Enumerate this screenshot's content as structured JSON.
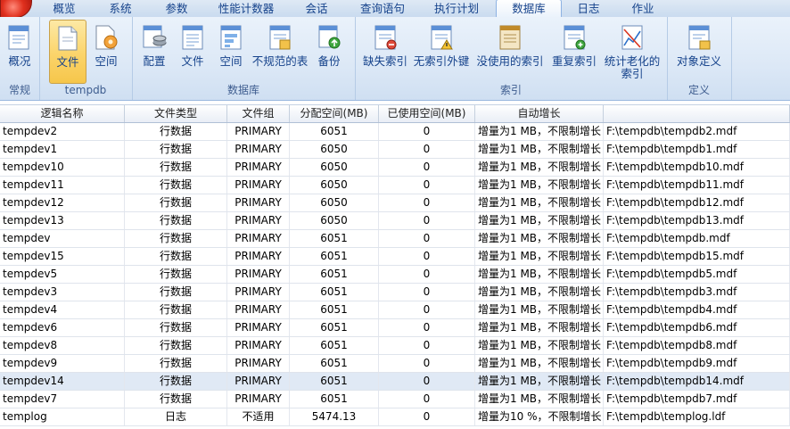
{
  "tabs": [
    {
      "label": "概览"
    },
    {
      "label": "系统"
    },
    {
      "label": "参数"
    },
    {
      "label": "性能计数器"
    },
    {
      "label": "会话"
    },
    {
      "label": "查询语句"
    },
    {
      "label": "执行计划"
    },
    {
      "label": "数据库",
      "active": true
    },
    {
      "label": "日志"
    },
    {
      "label": "作业"
    }
  ],
  "ribbon": {
    "groups": [
      {
        "label": "常规",
        "buttons": [
          {
            "label": "概况",
            "icon": "overview-icon"
          }
        ]
      },
      {
        "label": "tempdb",
        "buttons": [
          {
            "label": "文件",
            "icon": "file-icon",
            "pressed": true
          },
          {
            "label": "空间",
            "icon": "space-icon"
          }
        ]
      },
      {
        "label": "数据库",
        "buttons": [
          {
            "label": "配置",
            "icon": "config-icon"
          },
          {
            "label": "文件",
            "icon": "db-file-icon"
          },
          {
            "label": "空间",
            "icon": "db-space-icon"
          },
          {
            "label": "不规范的表",
            "icon": "irregular-table-icon"
          },
          {
            "label": "备份",
            "icon": "backup-icon"
          }
        ]
      },
      {
        "label": "索引",
        "buttons": [
          {
            "label": "缺失索引",
            "icon": "missing-index-icon"
          },
          {
            "label": "无索引外键",
            "icon": "unindexed-fk-icon"
          },
          {
            "label": "没使用的索引",
            "icon": "unused-index-icon"
          },
          {
            "label": "重复索引",
            "icon": "duplicate-index-icon"
          },
          {
            "label": "统计老化的\n索引",
            "icon": "stale-stats-icon"
          }
        ]
      },
      {
        "label": "定义",
        "buttons": [
          {
            "label": "对象定义",
            "icon": "object-definition-icon"
          }
        ]
      }
    ]
  },
  "grid": {
    "columns": [
      "逻辑名称",
      "文件类型",
      "文件组",
      "分配空间(MB)",
      "已使用空间(MB)",
      "自动增长",
      ""
    ],
    "rows": [
      [
        "tempdev2",
        "行数据",
        "PRIMARY",
        "6051",
        "0",
        "增量为1 MB，不限制增长",
        "F:\\tempdb\\tempdb2.mdf"
      ],
      [
        "tempdev1",
        "行数据",
        "PRIMARY",
        "6050",
        "0",
        "增量为1 MB，不限制增长",
        "F:\\tempdb\\tempdb1.mdf"
      ],
      [
        "tempdev10",
        "行数据",
        "PRIMARY",
        "6050",
        "0",
        "增量为1 MB，不限制增长",
        "F:\\tempdb\\tempdb10.mdf"
      ],
      [
        "tempdev11",
        "行数据",
        "PRIMARY",
        "6050",
        "0",
        "增量为1 MB，不限制增长",
        "F:\\tempdb\\tempdb11.mdf"
      ],
      [
        "tempdev12",
        "行数据",
        "PRIMARY",
        "6050",
        "0",
        "增量为1 MB，不限制增长",
        "F:\\tempdb\\tempdb12.mdf"
      ],
      [
        "tempdev13",
        "行数据",
        "PRIMARY",
        "6050",
        "0",
        "增量为1 MB，不限制增长",
        "F:\\tempdb\\tempdb13.mdf"
      ],
      [
        "tempdev",
        "行数据",
        "PRIMARY",
        "6051",
        "0",
        "增量为1 MB，不限制增长",
        "F:\\tempdb\\tempdb.mdf"
      ],
      [
        "tempdev15",
        "行数据",
        "PRIMARY",
        "6051",
        "0",
        "增量为1 MB，不限制增长",
        "F:\\tempdb\\tempdb15.mdf"
      ],
      [
        "tempdev5",
        "行数据",
        "PRIMARY",
        "6051",
        "0",
        "增量为1 MB，不限制增长",
        "F:\\tempdb\\tempdb5.mdf"
      ],
      [
        "tempdev3",
        "行数据",
        "PRIMARY",
        "6051",
        "0",
        "增量为1 MB，不限制增长",
        "F:\\tempdb\\tempdb3.mdf"
      ],
      [
        "tempdev4",
        "行数据",
        "PRIMARY",
        "6051",
        "0",
        "增量为1 MB，不限制增长",
        "F:\\tempdb\\tempdb4.mdf"
      ],
      [
        "tempdev6",
        "行数据",
        "PRIMARY",
        "6051",
        "0",
        "增量为1 MB，不限制增长",
        "F:\\tempdb\\tempdb6.mdf"
      ],
      [
        "tempdev8",
        "行数据",
        "PRIMARY",
        "6051",
        "0",
        "增量为1 MB，不限制增长",
        "F:\\tempdb\\tempdb8.mdf"
      ],
      [
        "tempdev9",
        "行数据",
        "PRIMARY",
        "6051",
        "0",
        "增量为1 MB，不限制增长",
        "F:\\tempdb\\tempdb9.mdf"
      ],
      [
        "tempdev14",
        "行数据",
        "PRIMARY",
        "6051",
        "0",
        "增量为1 MB，不限制增长",
        "F:\\tempdb\\tempdb14.mdf"
      ],
      [
        "tempdev7",
        "行数据",
        "PRIMARY",
        "6051",
        "0",
        "增量为1 MB，不限制增长",
        "F:\\tempdb\\tempdb7.mdf"
      ],
      [
        "templog",
        "日志",
        "不适用",
        "5474.13",
        "0",
        "增量为10 %，不限制增长",
        "F:\\tempdb\\templog.ldf"
      ]
    ],
    "selected_row": 14
  },
  "colors": {
    "accent": "#15428b",
    "ribbon_bg": "#dce8f6",
    "pressed": "#fbd46a",
    "selected_row": "#e0e9f5"
  }
}
